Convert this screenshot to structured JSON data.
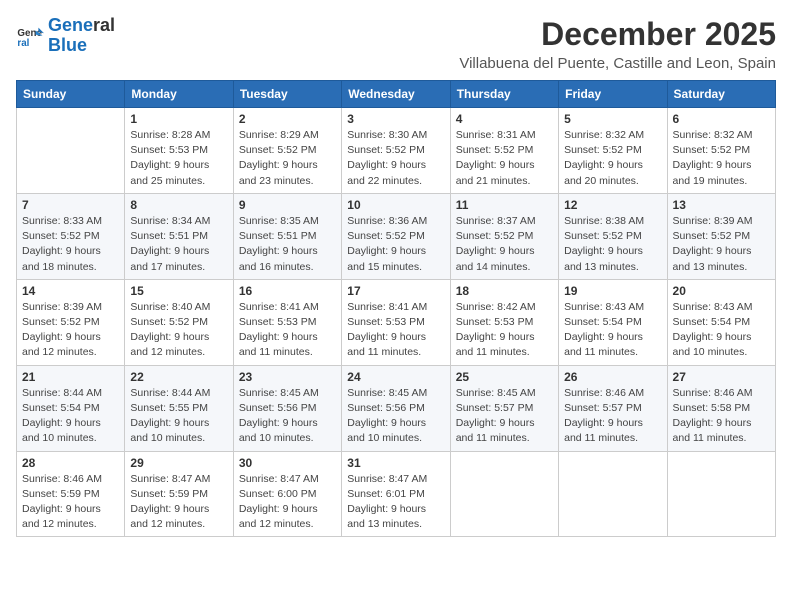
{
  "logo": {
    "line1": "General",
    "line2": "Blue"
  },
  "title": "December 2025",
  "subtitle": "Villabuena del Puente, Castille and Leon, Spain",
  "weekdays": [
    "Sunday",
    "Monday",
    "Tuesday",
    "Wednesday",
    "Thursday",
    "Friday",
    "Saturday"
  ],
  "weeks": [
    [
      {
        "day": "",
        "info": ""
      },
      {
        "day": "1",
        "info": "Sunrise: 8:28 AM\nSunset: 5:53 PM\nDaylight: 9 hours\nand 25 minutes."
      },
      {
        "day": "2",
        "info": "Sunrise: 8:29 AM\nSunset: 5:52 PM\nDaylight: 9 hours\nand 23 minutes."
      },
      {
        "day": "3",
        "info": "Sunrise: 8:30 AM\nSunset: 5:52 PM\nDaylight: 9 hours\nand 22 minutes."
      },
      {
        "day": "4",
        "info": "Sunrise: 8:31 AM\nSunset: 5:52 PM\nDaylight: 9 hours\nand 21 minutes."
      },
      {
        "day": "5",
        "info": "Sunrise: 8:32 AM\nSunset: 5:52 PM\nDaylight: 9 hours\nand 20 minutes."
      },
      {
        "day": "6",
        "info": "Sunrise: 8:32 AM\nSunset: 5:52 PM\nDaylight: 9 hours\nand 19 minutes."
      }
    ],
    [
      {
        "day": "7",
        "info": "Sunrise: 8:33 AM\nSunset: 5:52 PM\nDaylight: 9 hours\nand 18 minutes."
      },
      {
        "day": "8",
        "info": "Sunrise: 8:34 AM\nSunset: 5:51 PM\nDaylight: 9 hours\nand 17 minutes."
      },
      {
        "day": "9",
        "info": "Sunrise: 8:35 AM\nSunset: 5:51 PM\nDaylight: 9 hours\nand 16 minutes."
      },
      {
        "day": "10",
        "info": "Sunrise: 8:36 AM\nSunset: 5:52 PM\nDaylight: 9 hours\nand 15 minutes."
      },
      {
        "day": "11",
        "info": "Sunrise: 8:37 AM\nSunset: 5:52 PM\nDaylight: 9 hours\nand 14 minutes."
      },
      {
        "day": "12",
        "info": "Sunrise: 8:38 AM\nSunset: 5:52 PM\nDaylight: 9 hours\nand 13 minutes."
      },
      {
        "day": "13",
        "info": "Sunrise: 8:39 AM\nSunset: 5:52 PM\nDaylight: 9 hours\nand 13 minutes."
      }
    ],
    [
      {
        "day": "14",
        "info": "Sunrise: 8:39 AM\nSunset: 5:52 PM\nDaylight: 9 hours\nand 12 minutes."
      },
      {
        "day": "15",
        "info": "Sunrise: 8:40 AM\nSunset: 5:52 PM\nDaylight: 9 hours\nand 12 minutes."
      },
      {
        "day": "16",
        "info": "Sunrise: 8:41 AM\nSunset: 5:53 PM\nDaylight: 9 hours\nand 11 minutes."
      },
      {
        "day": "17",
        "info": "Sunrise: 8:41 AM\nSunset: 5:53 PM\nDaylight: 9 hours\nand 11 minutes."
      },
      {
        "day": "18",
        "info": "Sunrise: 8:42 AM\nSunset: 5:53 PM\nDaylight: 9 hours\nand 11 minutes."
      },
      {
        "day": "19",
        "info": "Sunrise: 8:43 AM\nSunset: 5:54 PM\nDaylight: 9 hours\nand 11 minutes."
      },
      {
        "day": "20",
        "info": "Sunrise: 8:43 AM\nSunset: 5:54 PM\nDaylight: 9 hours\nand 10 minutes."
      }
    ],
    [
      {
        "day": "21",
        "info": "Sunrise: 8:44 AM\nSunset: 5:54 PM\nDaylight: 9 hours\nand 10 minutes."
      },
      {
        "day": "22",
        "info": "Sunrise: 8:44 AM\nSunset: 5:55 PM\nDaylight: 9 hours\nand 10 minutes."
      },
      {
        "day": "23",
        "info": "Sunrise: 8:45 AM\nSunset: 5:56 PM\nDaylight: 9 hours\nand 10 minutes."
      },
      {
        "day": "24",
        "info": "Sunrise: 8:45 AM\nSunset: 5:56 PM\nDaylight: 9 hours\nand 10 minutes."
      },
      {
        "day": "25",
        "info": "Sunrise: 8:45 AM\nSunset: 5:57 PM\nDaylight: 9 hours\nand 11 minutes."
      },
      {
        "day": "26",
        "info": "Sunrise: 8:46 AM\nSunset: 5:57 PM\nDaylight: 9 hours\nand 11 minutes."
      },
      {
        "day": "27",
        "info": "Sunrise: 8:46 AM\nSunset: 5:58 PM\nDaylight: 9 hours\nand 11 minutes."
      }
    ],
    [
      {
        "day": "28",
        "info": "Sunrise: 8:46 AM\nSunset: 5:59 PM\nDaylight: 9 hours\nand 12 minutes."
      },
      {
        "day": "29",
        "info": "Sunrise: 8:47 AM\nSunset: 5:59 PM\nDaylight: 9 hours\nand 12 minutes."
      },
      {
        "day": "30",
        "info": "Sunrise: 8:47 AM\nSunset: 6:00 PM\nDaylight: 9 hours\nand 12 minutes."
      },
      {
        "day": "31",
        "info": "Sunrise: 8:47 AM\nSunset: 6:01 PM\nDaylight: 9 hours\nand 13 minutes."
      },
      {
        "day": "",
        "info": ""
      },
      {
        "day": "",
        "info": ""
      },
      {
        "day": "",
        "info": ""
      }
    ]
  ]
}
